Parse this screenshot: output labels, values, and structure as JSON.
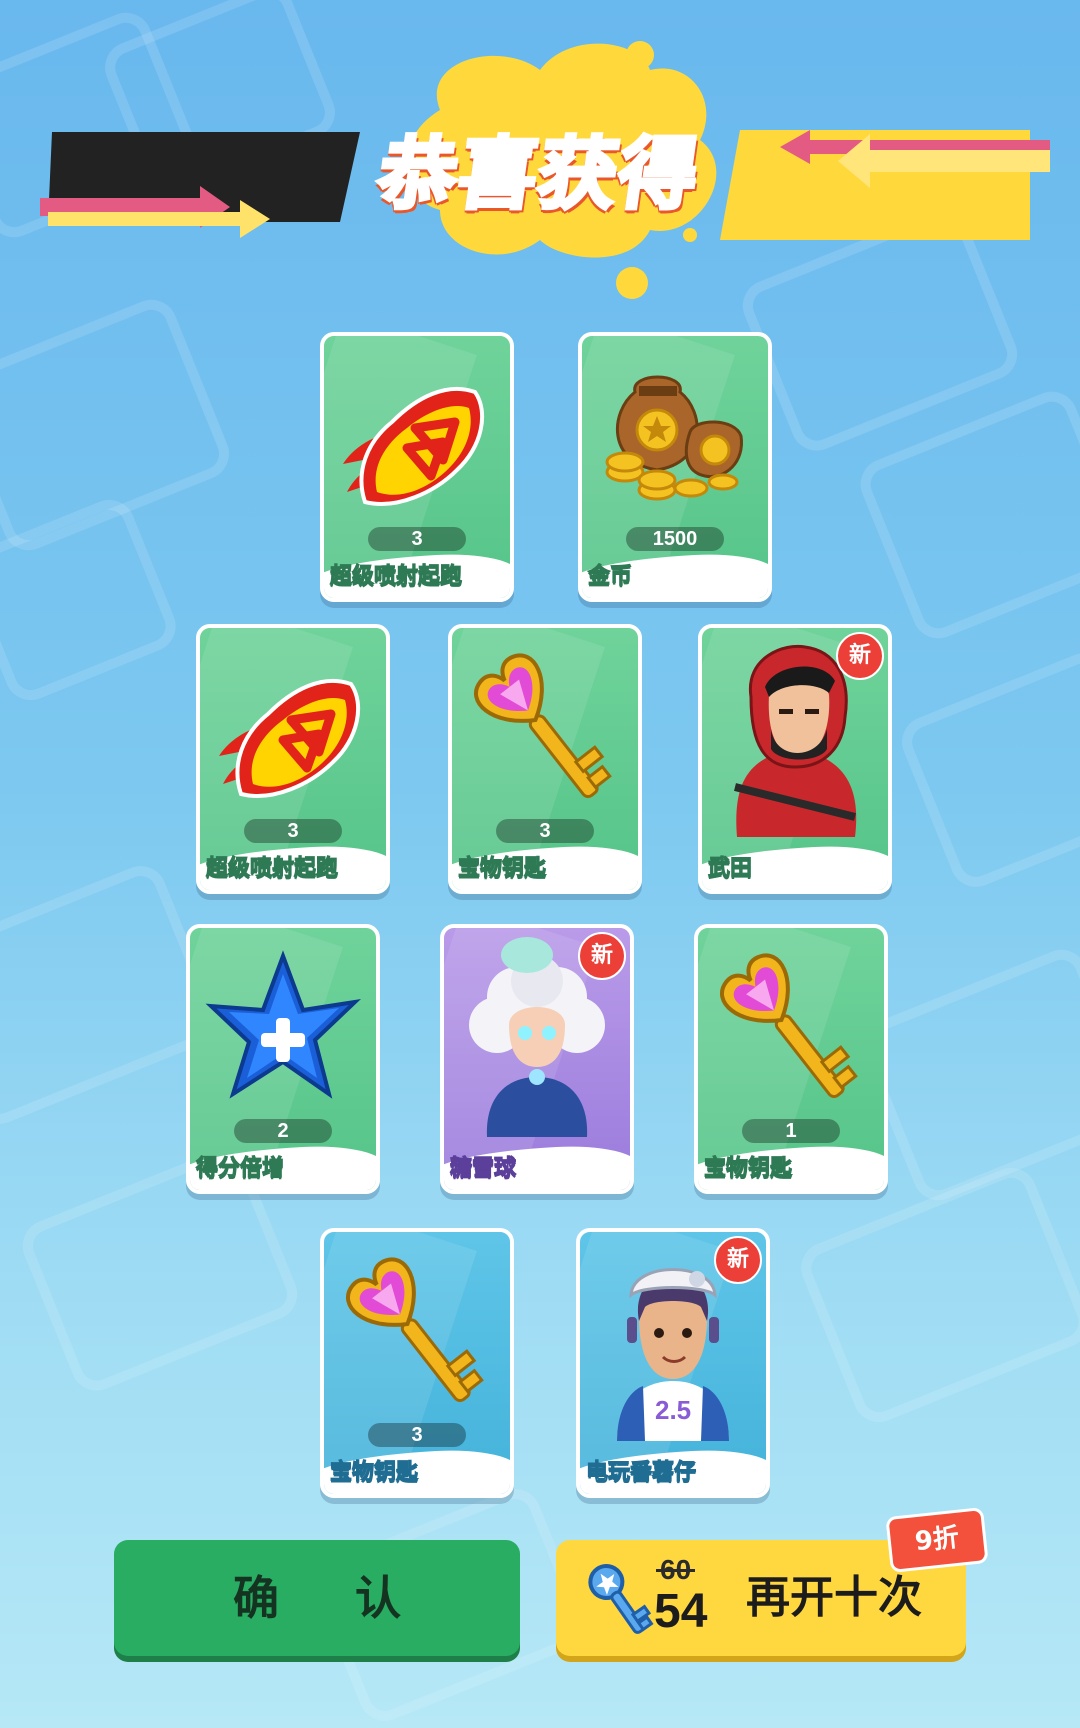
{
  "header": {
    "title": "恭喜获得"
  },
  "rewards": [
    {
      "name": "超级喷射起跑",
      "count": "3",
      "icon": "jet-boost-icon",
      "new": ""
    },
    {
      "name": "金币",
      "count": "1500",
      "icon": "coin-bags-icon",
      "new": ""
    },
    {
      "name": "超级喷射起跑",
      "count": "3",
      "icon": "jet-boost-icon",
      "new": ""
    },
    {
      "name": "宝物钥匙",
      "count": "3",
      "icon": "treasure-key-icon",
      "new": ""
    },
    {
      "name": "武田",
      "count": "",
      "icon": "character-takeda",
      "new": "新"
    },
    {
      "name": "得分倍增",
      "count": "2",
      "icon": "score-multiplier-star-icon",
      "new": ""
    },
    {
      "name": "糖雪球",
      "count": "",
      "icon": "character-snowball",
      "new": "新"
    },
    {
      "name": "宝物钥匙",
      "count": "1",
      "icon": "treasure-key-icon",
      "new": ""
    },
    {
      "name": "宝物钥匙",
      "count": "3",
      "icon": "treasure-key-icon",
      "new": ""
    },
    {
      "name": "电玩番薯仔",
      "count": "",
      "icon": "character-gamer-kid",
      "new": "新"
    }
  ],
  "buttons": {
    "confirm": "确 认",
    "again": {
      "label": "再开十次",
      "old_price": "60",
      "new_price": "54",
      "discount": "9折",
      "icon": "key-icon"
    }
  }
}
